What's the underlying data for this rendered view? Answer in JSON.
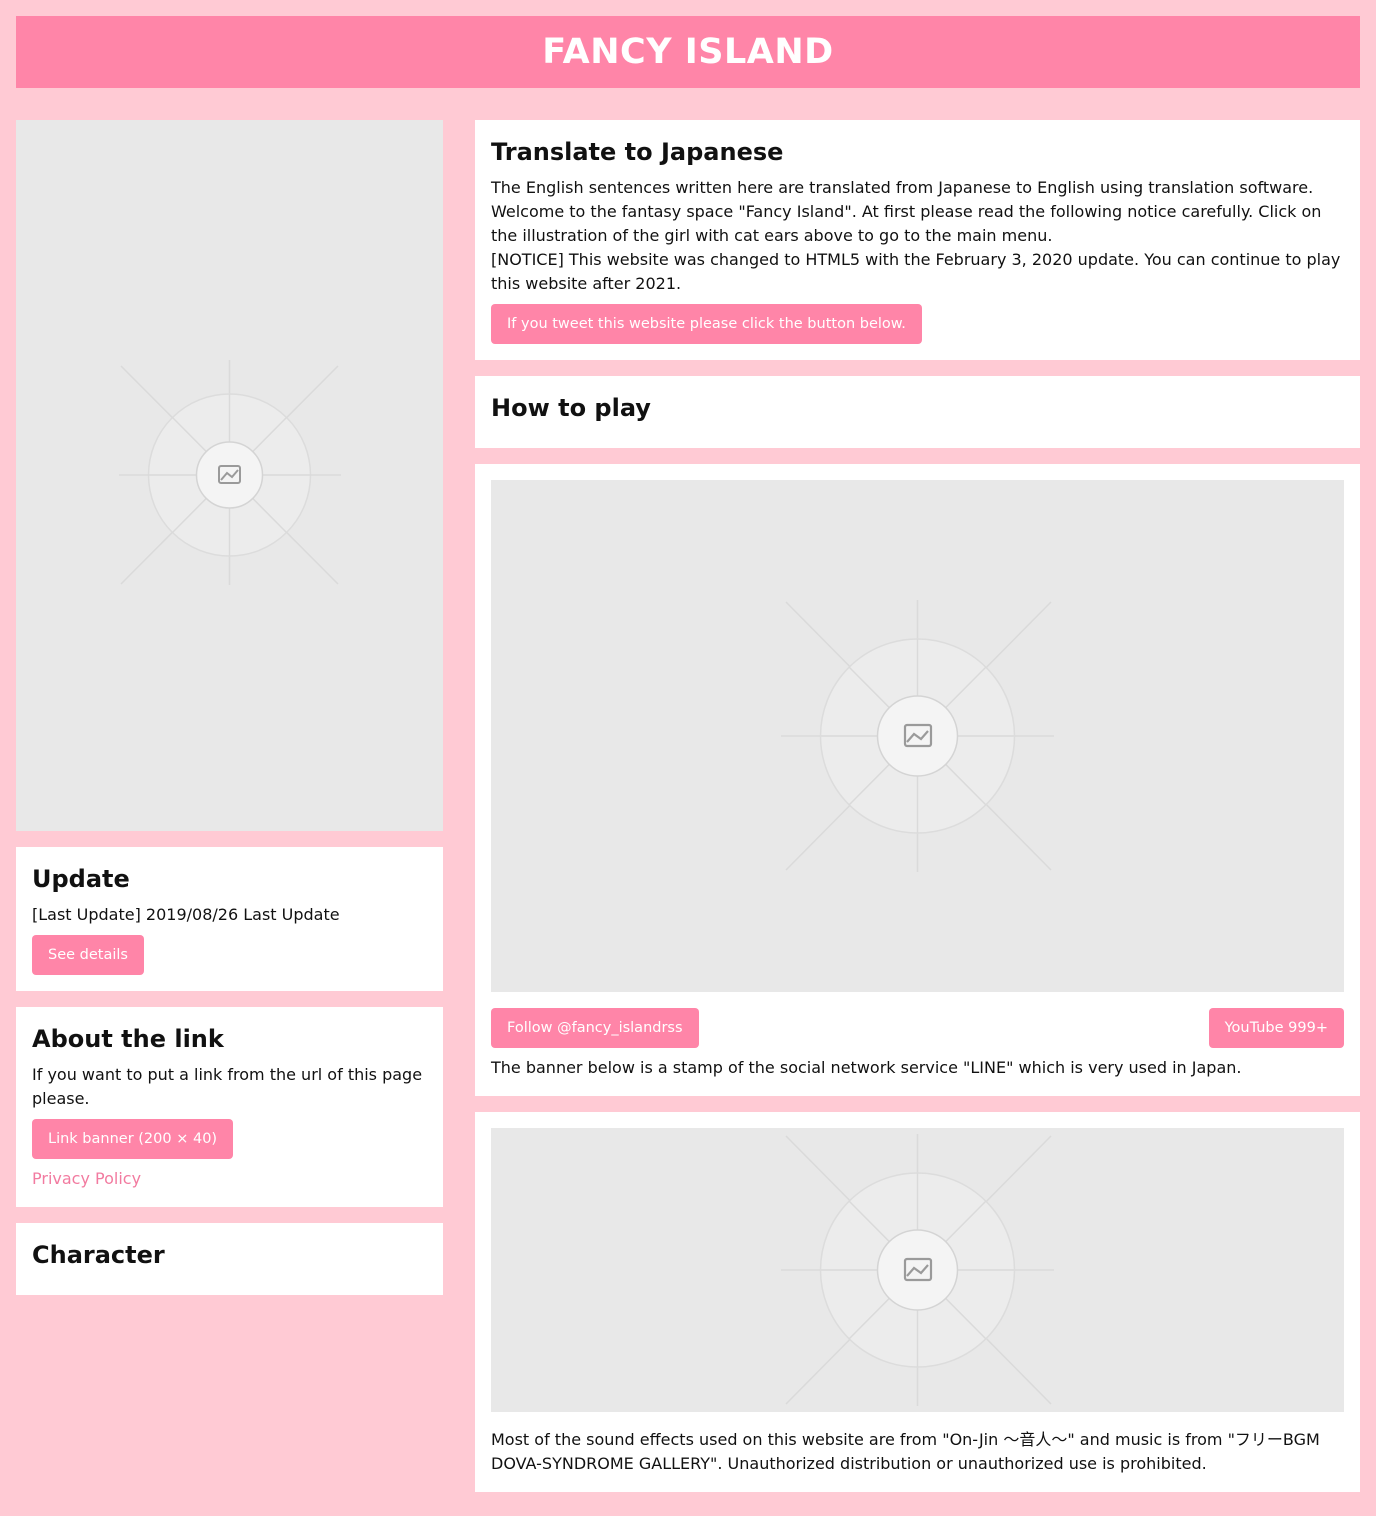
{
  "header": {
    "title": "FANCY ISLAND"
  },
  "left": {
    "update": {
      "title": "Update",
      "text": "[Last Update] 2019/08/26 Last Update",
      "button": "See details"
    },
    "about_link": {
      "title": "About the link",
      "text": "If you want to put a link from the url of this page please.",
      "button": "Link banner (200 × 40)",
      "privacy_link": "Privacy Policy"
    },
    "character": {
      "title": "Character"
    }
  },
  "right": {
    "translate": {
      "title": "Translate to Japanese",
      "line1": "The English sentences written here are translated from Japanese to English using translation software.",
      "line2": "Welcome to the fantasy space \"Fancy Island\". At first please read the following notice carefully. Click on the illustration of the girl with cat ears above to go to the main menu.",
      "line3": "[NOTICE] This website was changed to HTML5 with the February 3, 2020 update. You can continue to play this website after 2021.",
      "button": "If you tweet this website please click the button below."
    },
    "how_to_play": {
      "title": "How to play"
    },
    "video": {
      "follow_button": "Follow @fancy_islandrss",
      "youtube_button": "YouTube 999+",
      "line_text": "The banner below is a stamp of the social network service \"LINE\" which is very used in Japan."
    },
    "sound": {
      "text": "Most of the sound effects used on this website are from \"On-Jin 〜音人〜\" and music is from \"フリーBGM DOVA-SYNDROME GALLERY\". Unauthorized distribution or unauthorized use is prohibited."
    }
  },
  "colors": {
    "background": "#ffcad4",
    "accent": "#ff85a8",
    "panel": "#ffffff",
    "placeholder": "#e8e8e8",
    "link": "#f27ba0"
  },
  "icons": [
    "image-placeholder-icon"
  ]
}
